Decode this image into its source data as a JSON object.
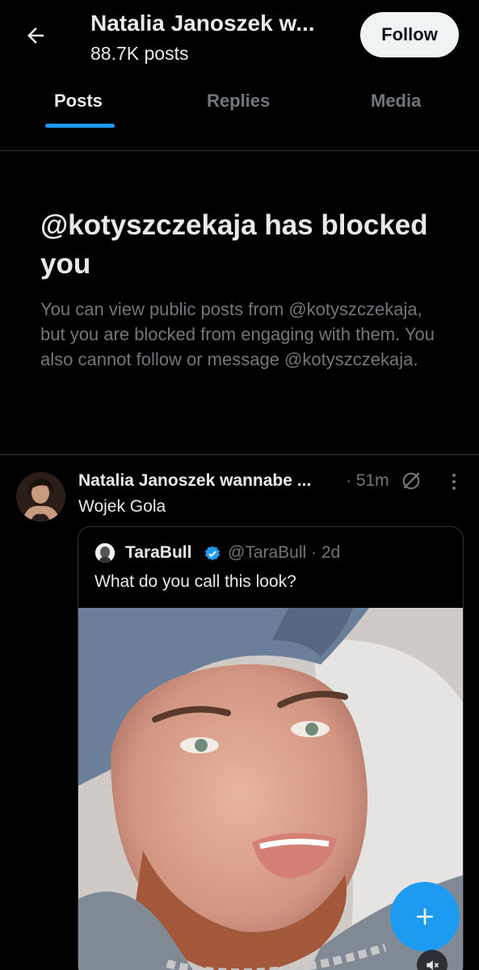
{
  "header": {
    "title": "Natalia Janoszek w...",
    "subtitle": "88.7K posts",
    "follow_label": "Follow"
  },
  "tabs": [
    {
      "label": "Posts",
      "active": true
    },
    {
      "label": "Replies",
      "active": false
    },
    {
      "label": "Media",
      "active": false
    }
  ],
  "blocked": {
    "title": "@kotyszczekaja has blocked you",
    "body": "You can view public posts from @kotyszczekaja, but you are blocked from engaging with them. You also cannot follow or message @kotyszczekaja."
  },
  "post": {
    "author": "Natalia Janoszek wannabe ...",
    "time": "· 51m",
    "text": "Wojek Gola",
    "quote": {
      "author": "TaraBull",
      "handle": "@TaraBull · 2d",
      "text": "What do you call this look?"
    }
  },
  "colors": {
    "accent": "#1d9bf0",
    "background": "#000000",
    "text_primary": "#e7e9ea",
    "text_secondary": "#71767b"
  },
  "icons": [
    "back-arrow-icon",
    "grok-icon",
    "more-icon",
    "verified-badge-icon",
    "plus-icon",
    "mute-icon"
  ]
}
